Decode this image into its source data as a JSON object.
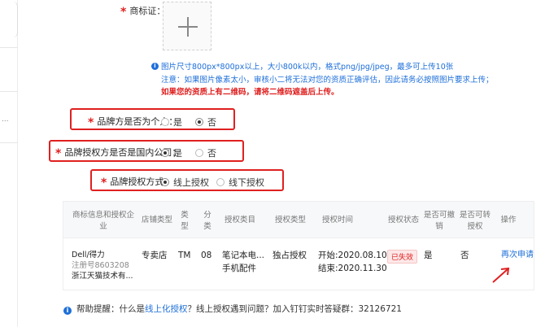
{
  "trademark": {
    "required_mark": "*",
    "label": "商标证："
  },
  "tips": {
    "info_glyph": "i",
    "line1": "图片尺寸800px*800px以上，大小800k以内，格式png/jpg/jpeg，最多可上传10张",
    "line2": "注意：如果图片像素太小，审核小二将无法对您的资质正确评估，因此请务必按照图片要求上传；",
    "line3": "如果您的资质上有二维码，请将二维码遮盖后上传。"
  },
  "q_individual": {
    "required_mark": "*",
    "label": "品牌方是否为个人：",
    "options": [
      "是",
      "否"
    ],
    "selected": "否"
  },
  "q_domestic": {
    "required_mark": "*",
    "label": "品牌授权方是否是国内公司：",
    "options": [
      "是",
      "否"
    ],
    "selected": "是"
  },
  "q_method": {
    "required_mark": "*",
    "label": "品牌授权方式：",
    "options": [
      "线上授权",
      "线下授权"
    ],
    "selected": "线上授权"
  },
  "table": {
    "headers": [
      "商标信息和授权企业",
      "店铺类型",
      "类型",
      "分类",
      "授权类目",
      "授权类型",
      "授权时间",
      "授权状态",
      "是否可撤销",
      "是否可转授权",
      "操作"
    ],
    "row": {
      "brand": "Dell/得力",
      "reg_no": "注册号8603208",
      "company": "浙江天猫技术有...",
      "shop_type": "专卖店",
      "type": "TM",
      "category": "08",
      "auth_category_1": "笔记本电...",
      "auth_category_2": "手机配件",
      "auth_type": "独占授权",
      "start": "开始:2020.08.10",
      "end": "结束:2020.11.30",
      "status": "已失效",
      "revocable": "是",
      "transferable": "否",
      "action": "再次申请"
    }
  },
  "help": {
    "info_glyph": "i",
    "prefix": "帮助提醒：什么是",
    "link": "线上化授权",
    "suffix": "？线上授权遇到问题？加入钉钉实时答疑群：32126721"
  },
  "left_rail": {
    "snippet": "..."
  },
  "colors": {
    "accent_blue": "#1e6fd9",
    "required_red": "#e02020",
    "box_red": "#e02020"
  }
}
